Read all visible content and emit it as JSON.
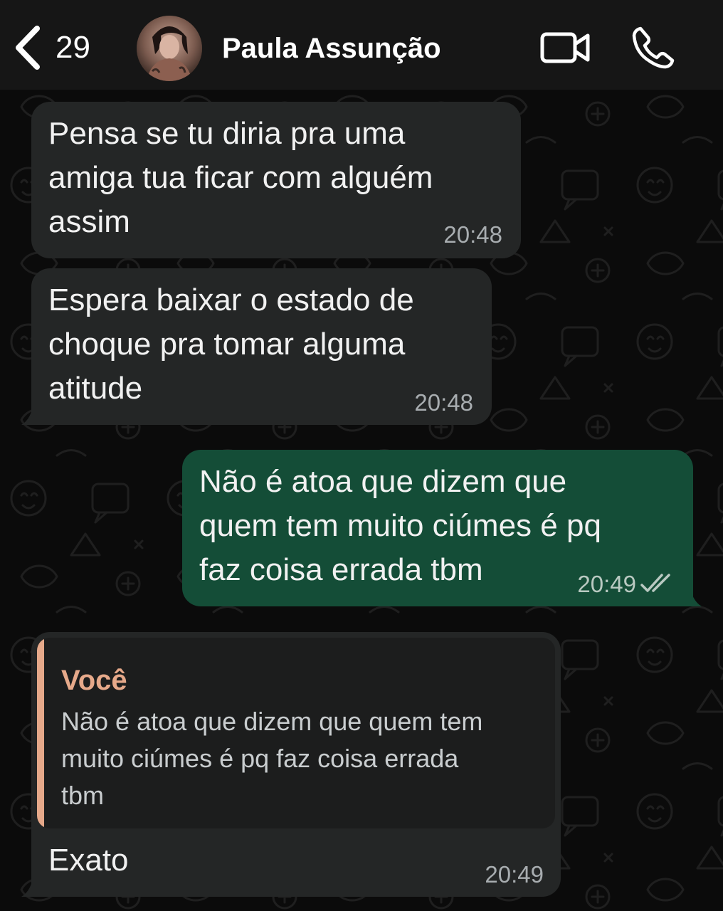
{
  "header": {
    "back_count": "29",
    "contact_name": "Paula Assunção"
  },
  "icons": {
    "back": "chevron-left-icon",
    "video": "video-camera-icon",
    "call": "phone-icon",
    "read_receipt": "double-check-icon"
  },
  "colors": {
    "incoming_bubble": "#242626",
    "outgoing_bubble": "#144d37",
    "quote_accent": "#e6a98a",
    "background": "#0b0b0b"
  },
  "messages": [
    {
      "direction": "incoming",
      "text": "Pensa se tu diria pra uma\namiga tua ficar com alguém\nassim",
      "time": "20:48"
    },
    {
      "direction": "incoming",
      "text": "Espera baixar o estado de\nchoque pra tomar alguma\natitude",
      "time": "20:48"
    },
    {
      "direction": "outgoing",
      "text": "Não é atoa que dizem que\nquem tem muito ciúmes é pq\nfaz coisa errada tbm",
      "time": "20:49",
      "status": "read"
    },
    {
      "direction": "incoming",
      "quote": {
        "author": "Você",
        "text": "Não é atoa que dizem que quem tem\nmuito ciúmes é pq faz coisa errada\ntbm"
      },
      "text": "Exato",
      "time": "20:49"
    }
  ]
}
